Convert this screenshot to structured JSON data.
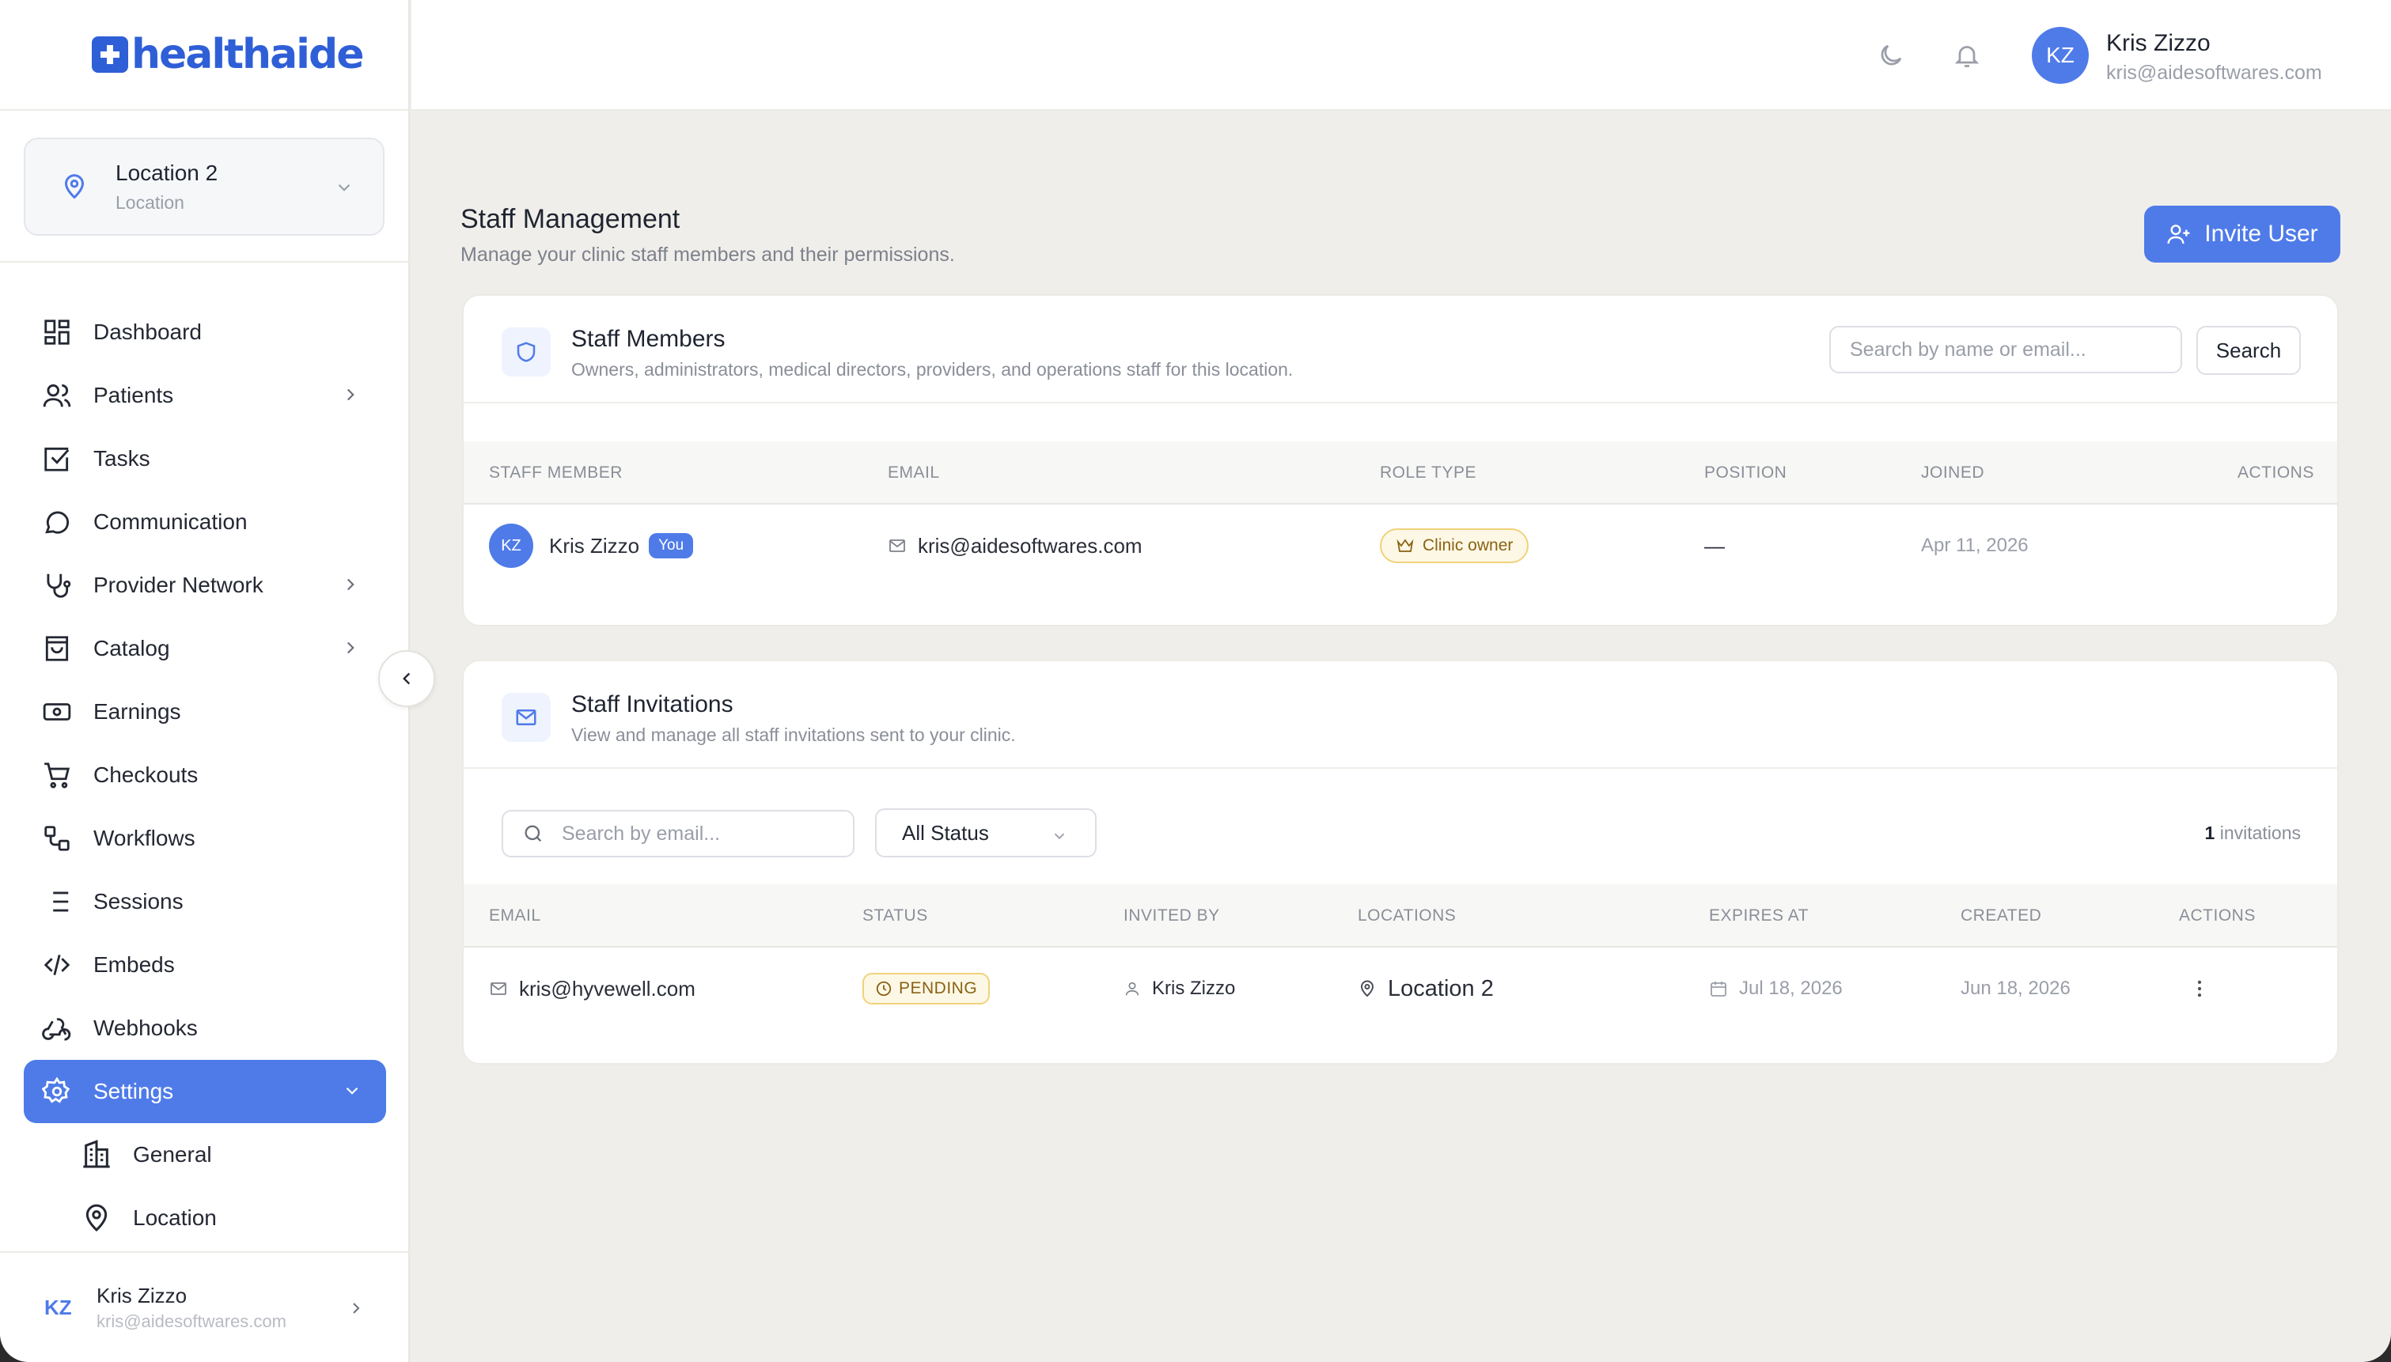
{
  "brand": {
    "name": "healthaide",
    "color": "#2f5fd7"
  },
  "accent": "#4f7be9",
  "location_switcher": {
    "name": "Location 2",
    "sub": "Location"
  },
  "sidebar": {
    "items": [
      {
        "label": "Dashboard",
        "icon": "dashboard-icon"
      },
      {
        "label": "Patients",
        "icon": "users-icon",
        "chevron": true
      },
      {
        "label": "Tasks",
        "icon": "checkbox-icon"
      },
      {
        "label": "Communication",
        "icon": "chat-bubble-icon"
      },
      {
        "label": "Provider Network",
        "icon": "stethoscope-icon",
        "chevron": true
      },
      {
        "label": "Catalog",
        "icon": "shopping-bag-icon",
        "chevron": true
      },
      {
        "label": "Earnings",
        "icon": "banknote-icon"
      },
      {
        "label": "Checkouts",
        "icon": "cart-icon"
      },
      {
        "label": "Workflows",
        "icon": "workflow-icon"
      },
      {
        "label": "Sessions",
        "icon": "list-icon"
      },
      {
        "label": "Embeds",
        "icon": "code-icon"
      },
      {
        "label": "Webhooks",
        "icon": "webhook-icon"
      },
      {
        "label": "Settings",
        "icon": "gear-icon",
        "active": true
      }
    ],
    "subitems": [
      {
        "label": "General",
        "icon": "building-icon"
      },
      {
        "label": "Location",
        "icon": "map-pin-icon"
      }
    ],
    "user": {
      "initials": "KZ",
      "name": "Kris Zizzo",
      "email": "kris@aidesoftwares.com"
    }
  },
  "header": {
    "user": {
      "initials": "KZ",
      "name": "Kris Zizzo",
      "email": "kris@aidesoftwares.com"
    }
  },
  "page": {
    "title": "Staff Management",
    "subtitle": "Manage your clinic staff members and their permissions.",
    "invite_label": "Invite User"
  },
  "staff": {
    "title": "Staff Members",
    "subtitle": "Owners, administrators, medical directors, providers, and operations staff for this location.",
    "search_placeholder": "Search by name or email...",
    "search_label": "Search",
    "columns": [
      "STAFF MEMBER",
      "EMAIL",
      "ROLE TYPE",
      "POSITION",
      "JOINED",
      "ACTIONS"
    ],
    "rows": [
      {
        "initials": "KZ",
        "name": "Kris Zizzo",
        "badge": "You",
        "email": "kris@aidesoftwares.com",
        "role": "Clinic owner",
        "position": "—",
        "joined": "Apr 11, 2026"
      }
    ]
  },
  "invitations": {
    "title": "Staff Invitations",
    "subtitle": "View and manage all staff invitations sent to your clinic.",
    "search_placeholder": "Search by email...",
    "status_filter": "All Status",
    "count": "1",
    "count_label": "invitations",
    "columns": [
      "EMAIL",
      "STATUS",
      "INVITED BY",
      "LOCATIONS",
      "EXPIRES AT",
      "CREATED",
      "ACTIONS"
    ],
    "rows": [
      {
        "email": "kris@hyvewell.com",
        "status": "PENDING",
        "invited_by": "Kris Zizzo",
        "location": "Location 2",
        "expires": "Jul 18, 2026",
        "created": "Jun 18, 2026"
      }
    ]
  }
}
